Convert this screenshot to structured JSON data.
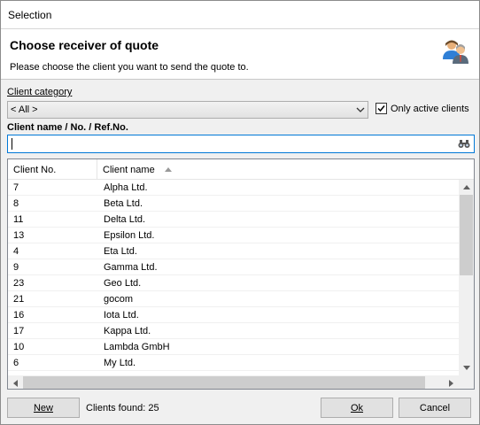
{
  "window": {
    "title": "Selection"
  },
  "header": {
    "title": "Choose receiver of quote",
    "subtitle": "Please choose the client you want to send the quote to.",
    "icon": "users-icon"
  },
  "filters": {
    "category_label": "Client category",
    "category_value": "< All >",
    "only_active_label": "Only active clients",
    "only_active_checked": true,
    "name_label": "Client name / No. / Ref.No.",
    "search_value": ""
  },
  "grid": {
    "columns": [
      "Client No.",
      "Client name"
    ],
    "sort_column": "Client name",
    "sort_direction": "ascending",
    "rows": [
      {
        "no": "7",
        "name": "Alpha Ltd."
      },
      {
        "no": "8",
        "name": "Beta Ltd."
      },
      {
        "no": "11",
        "name": "Delta Ltd."
      },
      {
        "no": "13",
        "name": "Epsilon Ltd."
      },
      {
        "no": "4",
        "name": "Eta Ltd."
      },
      {
        "no": "9",
        "name": "Gamma Ltd."
      },
      {
        "no": "23",
        "name": "Geo Ltd."
      },
      {
        "no": "21",
        "name": "gocom"
      },
      {
        "no": "16",
        "name": "Iota Ltd."
      },
      {
        "no": "17",
        "name": "Kappa Ltd."
      },
      {
        "no": "10",
        "name": "Lambda GmbH"
      },
      {
        "no": "6",
        "name": "My Ltd."
      }
    ]
  },
  "footer": {
    "new_label": "New",
    "clients_found_label": "Clients found:",
    "clients_found_count": "25",
    "ok_label": "Ok",
    "cancel_label": "Cancel"
  },
  "colors": {
    "focus_border": "#0078d7",
    "dialog_bg": "#f0f0f0"
  }
}
